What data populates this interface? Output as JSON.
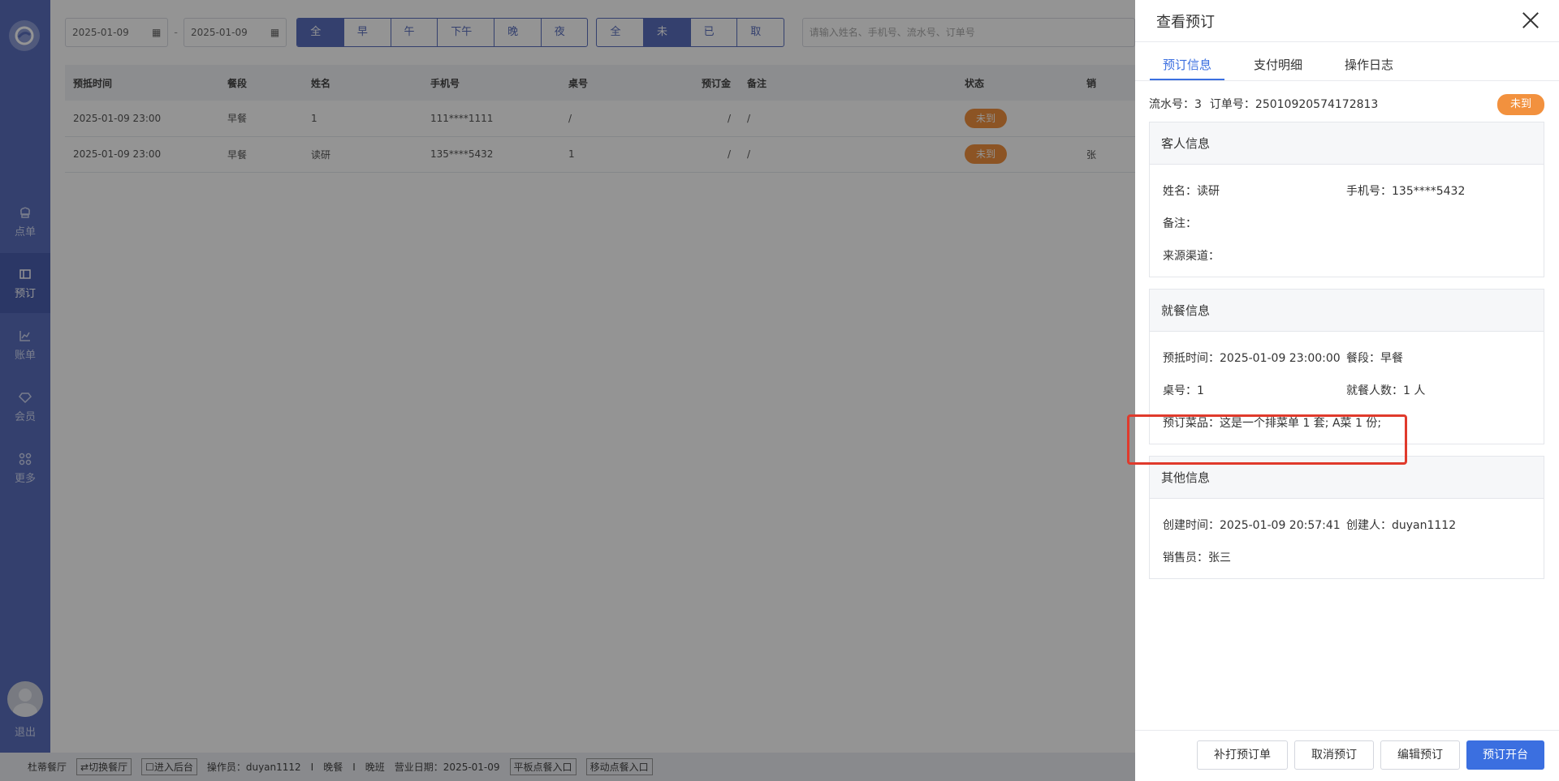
{
  "sidebar": {
    "items": [
      {
        "label": "点单",
        "icon": "chef-hat-icon"
      },
      {
        "label": "预订",
        "icon": "reservation-book-icon"
      },
      {
        "label": "账单",
        "icon": "chart-icon"
      },
      {
        "label": "会员",
        "icon": "diamond-icon"
      },
      {
        "label": "更多",
        "icon": "grid-icon"
      }
    ],
    "logout": "退出"
  },
  "filters": {
    "start_date": "2025-01-09",
    "end_date": "2025-01-09",
    "date_separator": "-",
    "meal_periods": [
      "全部",
      "早餐",
      "午餐",
      "下午茶",
      "晚餐",
      "夜宵"
    ],
    "statuses": [
      "全部",
      "未到",
      "已到",
      "取消"
    ],
    "search_placeholder": "请输入姓名、手机号、流水号、订单号"
  },
  "table": {
    "headers": [
      "预抵时间",
      "餐段",
      "姓名",
      "手机号",
      "桌号",
      "预订金",
      "备注",
      "状态",
      "销"
    ],
    "rows": [
      [
        "2025-01-09 23:00",
        "早餐",
        "1",
        "111****1111",
        "/",
        "/",
        "/",
        "未到",
        ""
      ],
      [
        "2025-01-09 23:00",
        "早餐",
        "读研",
        "135****5432",
        "1",
        "/",
        "/",
        "未到",
        "张"
      ]
    ]
  },
  "statusbar": {
    "restaurant": "杜蒂餐厅",
    "switch": "⇄切换餐厅",
    "backend": "☐进入后台",
    "operator": "操作员：duyan1112",
    "sep1": "I",
    "meal": "晚餐",
    "sep2": "I",
    "shift": "晚班",
    "business_date": "营业日期：2025-01-09",
    "tablet": "平板点餐入口",
    "mobile": "移动点餐入口"
  },
  "drawer": {
    "title": "查看预订",
    "tabs": [
      "预订信息",
      "支付明细",
      "操作日志"
    ],
    "serial": "流水号：3",
    "order_no": "订单号：25010920574172813",
    "status": "未到",
    "guest": {
      "title": "客人信息",
      "name": "姓名：读研",
      "phone": "手机号：135****5432",
      "remark": "备注：",
      "source": "来源渠道："
    },
    "dining": {
      "title": "就餐信息",
      "arrival": "预抵时间：2025-01-09 23:00:00",
      "period": "餐段：早餐",
      "table": "桌号：1",
      "people": "就餐人数：1 人",
      "dishes": "预订菜品：这是一个排菜单 1 套; A菜 1 份;"
    },
    "other": {
      "title": "其他信息",
      "created": "创建时间：2025-01-09 20:57:41",
      "creator": "创建人：duyan1112",
      "sales": "销售员：张三"
    },
    "buttons": {
      "reprint": "补打预订单",
      "cancel": "取消预订",
      "edit": "编辑预订",
      "open": "预订开台"
    }
  },
  "colors": {
    "accent": "#3b6fe0",
    "sidebar": "#5a6fbe",
    "status": "#f2913e",
    "highlight": "#e03a2c"
  }
}
